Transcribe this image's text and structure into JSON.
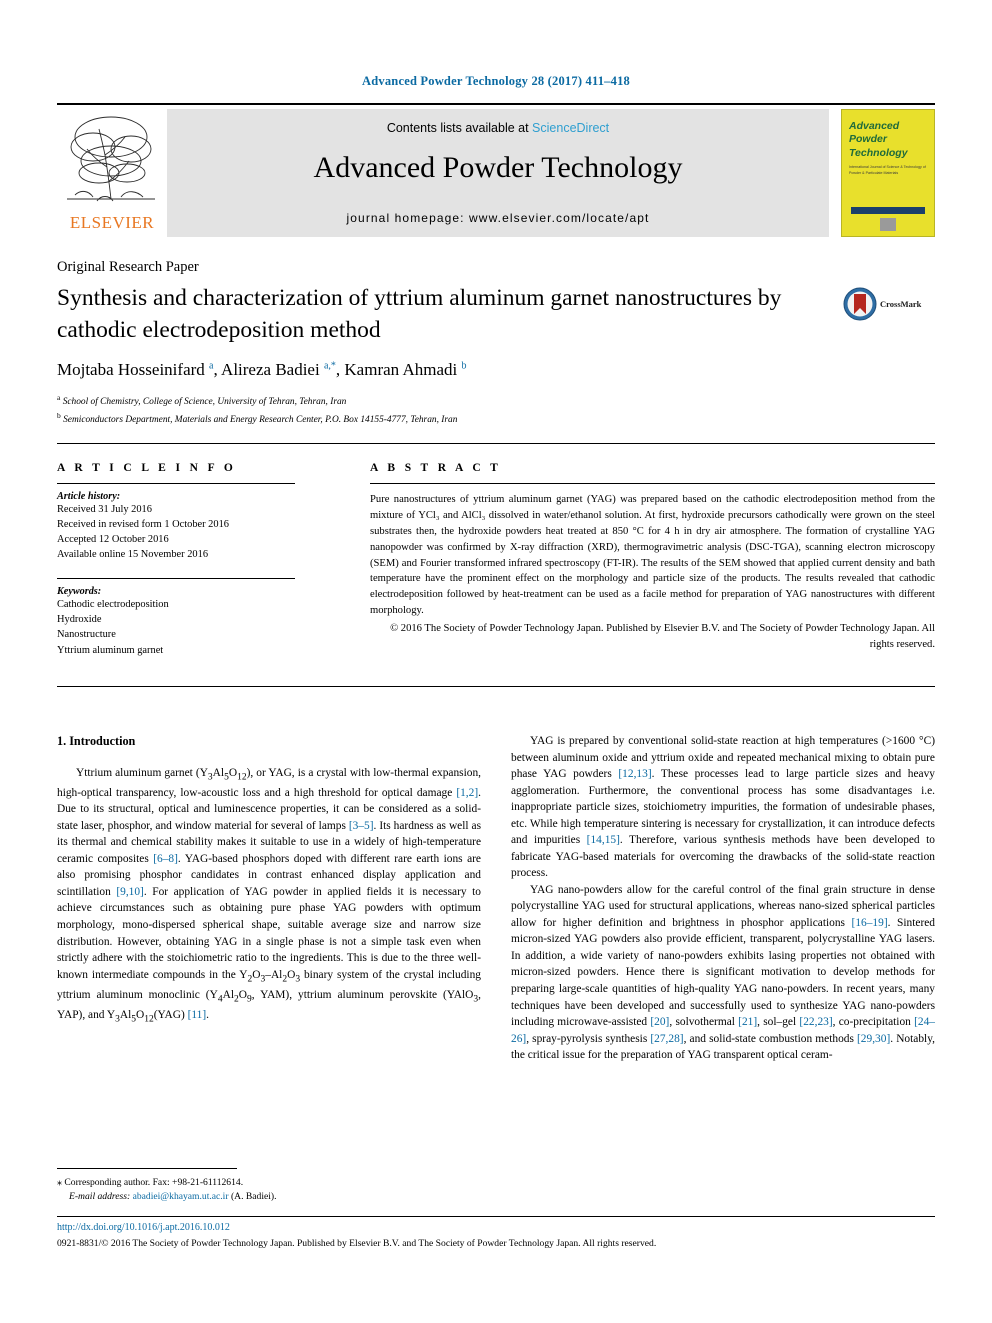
{
  "running_head": "Advanced Powder Technology 28 (2017) 411–418",
  "banner": {
    "publisher": "ELSEVIER",
    "contents_prefix": "Contents lists available at ",
    "contents_link": "ScienceDirect",
    "journal_name": "Advanced Powder Technology",
    "homepage": "journal homepage: www.elsevier.com/locate/apt",
    "cover": {
      "line1": "Advanced",
      "line2": "Powder",
      "line3": "Technology",
      "subtitle": "International Journal of Science & Technology of Powder & Particulate Materials"
    }
  },
  "article": {
    "type_label": "Original Research Paper",
    "title": "Synthesis and characterization of yttrium aluminum garnet nanostructures by cathodic electrodeposition method",
    "crossmark_label": "CrossMark",
    "authors_html": "Mojtaba Hosseinifard <sup>a</sup>, Alireza Badiei <sup>a,*</sup>, Kamran Ahmadi <sup>b</sup>",
    "affiliations": [
      "School of Chemistry, College of Science, University of Tehran, Tehran, Iran",
      "Semiconductors Department, Materials and Energy Research Center, P.O. Box 14155-4777, Tehran, Iran"
    ]
  },
  "article_info": {
    "heading": "A R T I C L E   I N F O",
    "history_label": "Article history:",
    "history": [
      "Received 31 July 2016",
      "Received in revised form 1 October 2016",
      "Accepted 12 October 2016",
      "Available online 15 November 2016"
    ],
    "keywords_label": "Keywords:",
    "keywords": [
      "Cathodic electrodeposition",
      "Hydroxide",
      "Nanostructure",
      "Yttrium aluminum garnet"
    ]
  },
  "abstract": {
    "heading": "A B S T R A C T",
    "text": "Pure nanostructures of yttrium aluminum garnet (YAG) was prepared based on the cathodic electrodeposition method from the mixture of YCl₃ and AlCl₃ dissolved in water/ethanol solution. At first, hydroxide precursors cathodically were grown on the steel substrates then, the hydroxide powders heat treated at 850 °C for 4 h in dry air atmosphere. The formation of crystalline YAG nanopowder was confirmed by X-ray diffraction (XRD), thermogravimetric analysis (DSC-TGA), scanning electron microscopy (SEM) and Fourier transformed infrared spectroscopy (FT-IR). The results of the SEM showed that applied current density and bath temperature have the prominent effect on the morphology and particle size of the products. The results revealed that cathodic electrodeposition followed by heat-treatment can be used as a facile method for preparation of YAG nanostructures with different morphology.",
    "copyright": "© 2016 The Society of Powder Technology Japan. Published by Elsevier B.V. and The Society of Powder Technology Japan. All rights reserved."
  },
  "body": {
    "section_heading": "1. Introduction",
    "left_paragraph_html": "Yttrium aluminum garnet (Y<sub>3</sub>Al<sub>5</sub>O<sub>12</sub>), or YAG, is a crystal with low-thermal expansion, high-optical transparency, low-acoustic loss and a high threshold for optical damage <span class=\"ref\">[1,2]</span>. Due to its structural, optical and luminescence properties, it can be considered as a solid-state laser, phosphor, and window material for several of lamps <span class=\"ref\">[3–5]</span>. Its hardness as well as its thermal and chemical stability makes it suitable to use in a widely of high-temperature ceramic composites <span class=\"ref\">[6–8]</span>. YAG-based phosphors doped with different rare earth ions are also promising phosphor candidates in contrast enhanced display application and scintillation <span class=\"ref\">[9,10]</span>. For application of YAG powder in applied fields it is necessary to achieve circumstances such as obtaining pure phase YAG powders with optimum morphology, mono-dispersed spherical shape, suitable average size and narrow size distribution. However, obtaining YAG in a single phase is not a simple task even when strictly adhere with the stoichiometric ratio to the ingredients. This is due to the three well-known intermediate compounds in the Y<sub>2</sub>O<sub>3</sub>–Al<sub>2</sub>O<sub>3</sub> binary system of the crystal including yttrium aluminum monoclinic (Y<sub>4</sub>Al<sub>2</sub>O<sub>9</sub>, YAM), yttrium aluminum perovskite (YAlO<sub>3</sub>, YAP), and Y<sub>3</sub>Al<sub>5</sub>O<sub>12</sub>(YAG) <span class=\"ref\">[11]</span>.",
    "right_paragraph_1_html": "YAG is prepared by conventional solid-state reaction at high temperatures (&gt;1600 °C) between aluminum oxide and yttrium oxide and repeated mechanical mixing to obtain pure phase YAG powders <span class=\"ref\">[12,13]</span>. These processes lead to large particle sizes and heavy agglomeration. Furthermore, the conventional process has some disadvantages i.e. inappropriate particle sizes, stoichiometry impurities, the formation of undesirable phases, etc. While high temperature sintering is necessary for crystallization, it can introduce defects and impurities <span class=\"ref\">[14,15]</span>. Therefore, various synthesis methods have been developed to fabricate YAG-based materials for overcoming the drawbacks of the solid-state reaction process.",
    "right_paragraph_2_html": "YAG nano-powders allow for the careful control of the final grain structure in dense polycrystalline YAG used for structural applications, whereas nano-sized spherical particles allow for higher definition and brightness in phosphor applications <span class=\"ref\">[16–19]</span>. Sintered micron-sized YAG powders also provide efficient, transparent, polycrystalline YAG lasers. In addition, a wide variety of nano-powders exhibits lasing properties not obtained with micron-sized powders. Hence there is significant motivation to develop methods for preparing large-scale quantities of high-quality YAG nano-powders. In recent years, many techniques have been developed and successfully used to synthesize YAG nano-powders including microwave-assisted <span class=\"ref\">[20]</span>, solvothermal <span class=\"ref\">[21]</span>, sol–gel <span class=\"ref\">[22,23]</span>, co-precipitation <span class=\"ref\">[24–26]</span>, spray-pyrolysis synthesis <span class=\"ref\">[27,28]</span>, and solid-state combustion methods <span class=\"ref\">[29,30]</span>. Notably, the critical issue for the preparation of YAG transparent optical ceram-"
  },
  "footer": {
    "corresponding_html": "<span style=\"font-size:10px\">⁎</span> Corresponding author. Fax: +98-21-61112614.",
    "email_label": "E-mail address:",
    "email": "abadiei@khayam.ut.ac.ir",
    "email_suffix": " (A. Badiei).",
    "doi": "http://dx.doi.org/10.1016/j.apt.2016.10.012",
    "issn": "0921-8831/© 2016 The Society of Powder Technology Japan. Published by Elsevier B.V. and The Society of Powder Technology Japan. All rights reserved."
  },
  "colors": {
    "link_blue": "#0b6aa2",
    "sciencedirect_blue": "#2f9fd0",
    "elsevier_orange": "#e87722",
    "cover_yellow": "#e8e02c",
    "cover_green": "#1f6b3b"
  }
}
